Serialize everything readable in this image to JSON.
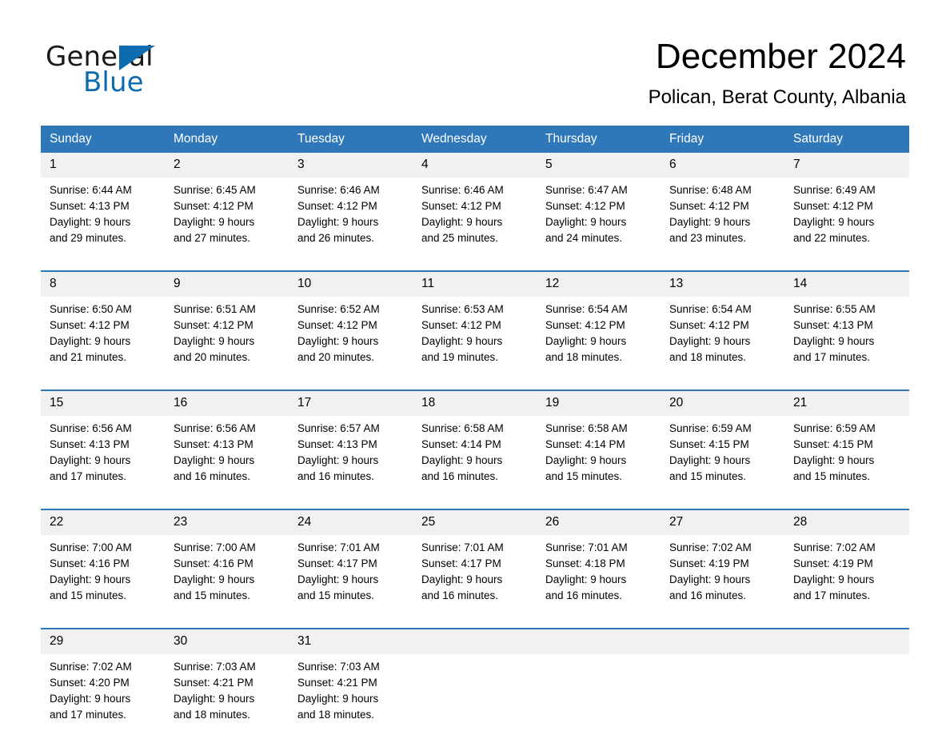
{
  "brand": {
    "name_part1": "General",
    "name_part2": "Blue",
    "triangle_icon": "triangle-logo-icon",
    "accent_color": "#0d6cb0"
  },
  "header": {
    "title": "December 2024",
    "subtitle": "Polican, Berat County, Albania"
  },
  "theme": {
    "header_blue": "#2e77b8",
    "daynum_gray": "#f1f1f1",
    "text_black": "#000000"
  },
  "calendar": {
    "weekday_headers": [
      "Sunday",
      "Monday",
      "Tuesday",
      "Wednesday",
      "Thursday",
      "Friday",
      "Saturday"
    ],
    "weeks": [
      {
        "days": [
          {
            "num": "1",
            "sunrise": "Sunrise: 6:44 AM",
            "sunset": "Sunset: 4:13 PM",
            "daylight1": "Daylight: 9 hours",
            "daylight2": "and 29 minutes."
          },
          {
            "num": "2",
            "sunrise": "Sunrise: 6:45 AM",
            "sunset": "Sunset: 4:12 PM",
            "daylight1": "Daylight: 9 hours",
            "daylight2": "and 27 minutes."
          },
          {
            "num": "3",
            "sunrise": "Sunrise: 6:46 AM",
            "sunset": "Sunset: 4:12 PM",
            "daylight1": "Daylight: 9 hours",
            "daylight2": "and 26 minutes."
          },
          {
            "num": "4",
            "sunrise": "Sunrise: 6:46 AM",
            "sunset": "Sunset: 4:12 PM",
            "daylight1": "Daylight: 9 hours",
            "daylight2": "and 25 minutes."
          },
          {
            "num": "5",
            "sunrise": "Sunrise: 6:47 AM",
            "sunset": "Sunset: 4:12 PM",
            "daylight1": "Daylight: 9 hours",
            "daylight2": "and 24 minutes."
          },
          {
            "num": "6",
            "sunrise": "Sunrise: 6:48 AM",
            "sunset": "Sunset: 4:12 PM",
            "daylight1": "Daylight: 9 hours",
            "daylight2": "and 23 minutes."
          },
          {
            "num": "7",
            "sunrise": "Sunrise: 6:49 AM",
            "sunset": "Sunset: 4:12 PM",
            "daylight1": "Daylight: 9 hours",
            "daylight2": "and 22 minutes."
          }
        ]
      },
      {
        "days": [
          {
            "num": "8",
            "sunrise": "Sunrise: 6:50 AM",
            "sunset": "Sunset: 4:12 PM",
            "daylight1": "Daylight: 9 hours",
            "daylight2": "and 21 minutes."
          },
          {
            "num": "9",
            "sunrise": "Sunrise: 6:51 AM",
            "sunset": "Sunset: 4:12 PM",
            "daylight1": "Daylight: 9 hours",
            "daylight2": "and 20 minutes."
          },
          {
            "num": "10",
            "sunrise": "Sunrise: 6:52 AM",
            "sunset": "Sunset: 4:12 PM",
            "daylight1": "Daylight: 9 hours",
            "daylight2": "and 20 minutes."
          },
          {
            "num": "11",
            "sunrise": "Sunrise: 6:53 AM",
            "sunset": "Sunset: 4:12 PM",
            "daylight1": "Daylight: 9 hours",
            "daylight2": "and 19 minutes."
          },
          {
            "num": "12",
            "sunrise": "Sunrise: 6:54 AM",
            "sunset": "Sunset: 4:12 PM",
            "daylight1": "Daylight: 9 hours",
            "daylight2": "and 18 minutes."
          },
          {
            "num": "13",
            "sunrise": "Sunrise: 6:54 AM",
            "sunset": "Sunset: 4:12 PM",
            "daylight1": "Daylight: 9 hours",
            "daylight2": "and 18 minutes."
          },
          {
            "num": "14",
            "sunrise": "Sunrise: 6:55 AM",
            "sunset": "Sunset: 4:13 PM",
            "daylight1": "Daylight: 9 hours",
            "daylight2": "and 17 minutes."
          }
        ]
      },
      {
        "days": [
          {
            "num": "15",
            "sunrise": "Sunrise: 6:56 AM",
            "sunset": "Sunset: 4:13 PM",
            "daylight1": "Daylight: 9 hours",
            "daylight2": "and 17 minutes."
          },
          {
            "num": "16",
            "sunrise": "Sunrise: 6:56 AM",
            "sunset": "Sunset: 4:13 PM",
            "daylight1": "Daylight: 9 hours",
            "daylight2": "and 16 minutes."
          },
          {
            "num": "17",
            "sunrise": "Sunrise: 6:57 AM",
            "sunset": "Sunset: 4:13 PM",
            "daylight1": "Daylight: 9 hours",
            "daylight2": "and 16 minutes."
          },
          {
            "num": "18",
            "sunrise": "Sunrise: 6:58 AM",
            "sunset": "Sunset: 4:14 PM",
            "daylight1": "Daylight: 9 hours",
            "daylight2": "and 16 minutes."
          },
          {
            "num": "19",
            "sunrise": "Sunrise: 6:58 AM",
            "sunset": "Sunset: 4:14 PM",
            "daylight1": "Daylight: 9 hours",
            "daylight2": "and 15 minutes."
          },
          {
            "num": "20",
            "sunrise": "Sunrise: 6:59 AM",
            "sunset": "Sunset: 4:15 PM",
            "daylight1": "Daylight: 9 hours",
            "daylight2": "and 15 minutes."
          },
          {
            "num": "21",
            "sunrise": "Sunrise: 6:59 AM",
            "sunset": "Sunset: 4:15 PM",
            "daylight1": "Daylight: 9 hours",
            "daylight2": "and 15 minutes."
          }
        ]
      },
      {
        "days": [
          {
            "num": "22",
            "sunrise": "Sunrise: 7:00 AM",
            "sunset": "Sunset: 4:16 PM",
            "daylight1": "Daylight: 9 hours",
            "daylight2": "and 15 minutes."
          },
          {
            "num": "23",
            "sunrise": "Sunrise: 7:00 AM",
            "sunset": "Sunset: 4:16 PM",
            "daylight1": "Daylight: 9 hours",
            "daylight2": "and 15 minutes."
          },
          {
            "num": "24",
            "sunrise": "Sunrise: 7:01 AM",
            "sunset": "Sunset: 4:17 PM",
            "daylight1": "Daylight: 9 hours",
            "daylight2": "and 15 minutes."
          },
          {
            "num": "25",
            "sunrise": "Sunrise: 7:01 AM",
            "sunset": "Sunset: 4:17 PM",
            "daylight1": "Daylight: 9 hours",
            "daylight2": "and 16 minutes."
          },
          {
            "num": "26",
            "sunrise": "Sunrise: 7:01 AM",
            "sunset": "Sunset: 4:18 PM",
            "daylight1": "Daylight: 9 hours",
            "daylight2": "and 16 minutes."
          },
          {
            "num": "27",
            "sunrise": "Sunrise: 7:02 AM",
            "sunset": "Sunset: 4:19 PM",
            "daylight1": "Daylight: 9 hours",
            "daylight2": "and 16 minutes."
          },
          {
            "num": "28",
            "sunrise": "Sunrise: 7:02 AM",
            "sunset": "Sunset: 4:19 PM",
            "daylight1": "Daylight: 9 hours",
            "daylight2": "and 17 minutes."
          }
        ]
      },
      {
        "days": [
          {
            "num": "29",
            "sunrise": "Sunrise: 7:02 AM",
            "sunset": "Sunset: 4:20 PM",
            "daylight1": "Daylight: 9 hours",
            "daylight2": "and 17 minutes."
          },
          {
            "num": "30",
            "sunrise": "Sunrise: 7:03 AM",
            "sunset": "Sunset: 4:21 PM",
            "daylight1": "Daylight: 9 hours",
            "daylight2": "and 18 minutes."
          },
          {
            "num": "31",
            "sunrise": "Sunrise: 7:03 AM",
            "sunset": "Sunset: 4:21 PM",
            "daylight1": "Daylight: 9 hours",
            "daylight2": "and 18 minutes."
          },
          {
            "num": "",
            "sunrise": "",
            "sunset": "",
            "daylight1": "",
            "daylight2": ""
          },
          {
            "num": "",
            "sunrise": "",
            "sunset": "",
            "daylight1": "",
            "daylight2": ""
          },
          {
            "num": "",
            "sunrise": "",
            "sunset": "",
            "daylight1": "",
            "daylight2": ""
          },
          {
            "num": "",
            "sunrise": "",
            "sunset": "",
            "daylight1": "",
            "daylight2": ""
          }
        ]
      }
    ]
  }
}
